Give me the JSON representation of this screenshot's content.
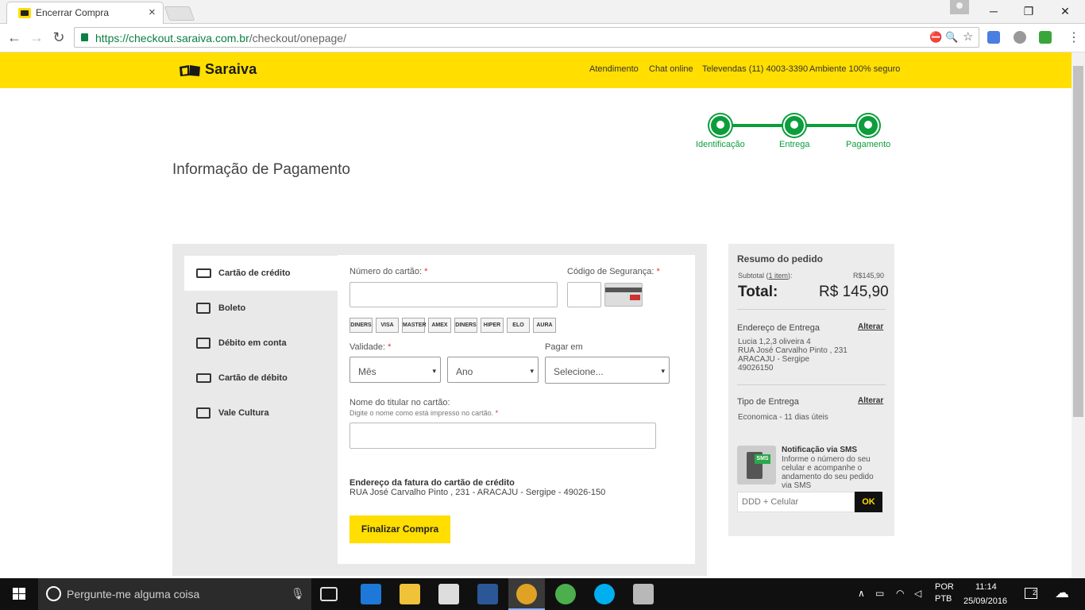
{
  "browser": {
    "tab_title": "Encerrar Compra",
    "url_host": "https://checkout.saraiva.com.br",
    "url_path": "/checkout/onepage/"
  },
  "header": {
    "logo": "Saraiva",
    "links": [
      "Atendimento",
      "Chat online",
      "Televendas (11) 4003-3390",
      "Ambiente 100% seguro"
    ]
  },
  "steps": [
    "Identificação",
    "Entrega",
    "Pagamento"
  ],
  "page_title": "Informação de Pagamento",
  "payment_methods": [
    "Cartão de crédito",
    "Boleto",
    "Débito em conta",
    "Cartão de débito",
    "Vale Cultura"
  ],
  "form": {
    "card_number_label": "Número do cartão:",
    "security_code_label": "Código de Segurança:",
    "card_brands": [
      "DINERS",
      "VISA",
      "MASTER",
      "AMEX",
      "DINERS",
      "HIPER",
      "ELO",
      "AURA"
    ],
    "validity_label": "Validade:",
    "month_value": "Mês",
    "year_value": "Ano",
    "pay_in_label": "Pagar em",
    "pay_in_value": "Selecione...",
    "holder_label": "Nome do titular no cartão:",
    "holder_hint": "Digite o nome como está impresso no cartão.",
    "billing_title": "Endereço da fatura do cartão de crédito",
    "billing_address": "RUA José Carvalho Pinto , 231 - ARACAJU - Sergipe - 49026-150",
    "submit": "Finalizar Compra",
    "required_mark": "*"
  },
  "summary": {
    "title": "Resumo do pedido",
    "subtotal_prefix": "Subtotal (",
    "subtotal_items": "1 item",
    "subtotal_suffix": "):",
    "subtotal_value": "R$145,90",
    "total_label": "Total:",
    "total_value": "R$ 145,90",
    "address_title": "Endereço de Entrega",
    "address_change": "Alterar",
    "address_lines": [
      "Lucia 1,2,3 oliveira 4",
      "RUA José Carvalho Pinto , 231",
      "ARACAJU - Sergipe",
      "49026150"
    ],
    "delivery_title": "Tipo de Entrega",
    "delivery_change": "Alterar",
    "delivery_value": "Economica - 11 dias úteis",
    "sms_title": "Notificação via SMS",
    "sms_text": "Informe o número do seu celular e acompanhe o andamento do seu pedido via SMS",
    "sms_badge": "SMS",
    "sms_placeholder": "DDD + Celular",
    "sms_button": "OK"
  },
  "taskbar": {
    "search_placeholder": "Pergunte-me alguma coisa",
    "lang_1": "POR",
    "lang_2": "PTB",
    "time": "11:14",
    "date": "25/09/2016",
    "notifications": "2"
  }
}
